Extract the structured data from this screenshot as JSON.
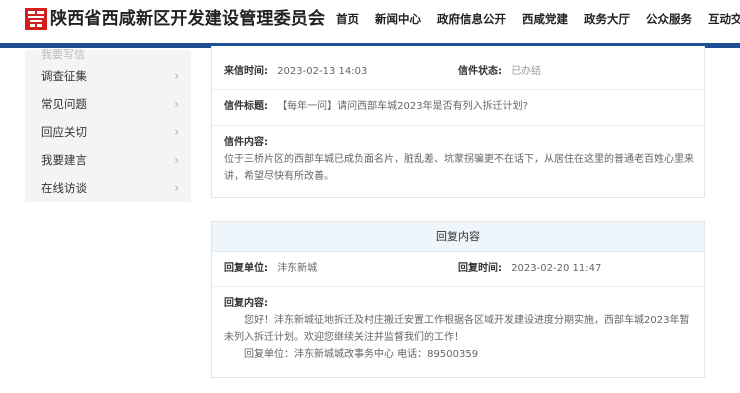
{
  "header": {
    "logo_icon": "red-seal-logo-icon",
    "title": "陕西省西咸新区开发建设管理委员会",
    "nav": [
      "首页",
      "新闻中心",
      "政府信息公开",
      "西咸党建",
      "政务大厅",
      "公众服务",
      "互动交流"
    ],
    "bar_color": "#1f4f95"
  },
  "sidebar": {
    "partial_item": "我要写信",
    "items": [
      "调查征集",
      "常见问题",
      "回应关切",
      "我要建言",
      "在线访谈"
    ],
    "chevron_icon": "chevron-right-icon"
  },
  "letter": {
    "time_label": "来信时间:",
    "time_value": "2023-02-13 14:03",
    "status_label": "信件状态:",
    "status_value": "已办结",
    "subject_label": "信件标题:",
    "subject_value": "【每年一问】请问西部车城2023年是否有列入拆迁计划?",
    "content_label": "信件内容:",
    "content_value": "位于三桥片区的西部车城已成负面名片，脏乱差、坑蒙拐骗更不在话下，从居住在这里的普通老百姓心里来讲，希望尽快有所改善。"
  },
  "reply": {
    "heading": "回复内容",
    "unit_label": "回复单位:",
    "unit_value": "沣东新城",
    "time_label": "回复时间:",
    "time_value": "2023-02-20 11:47",
    "content_label": "回复内容:",
    "content_value": "您好！沣东新城征地拆迁及村庄搬迁安置工作根据各区域开发建设进度分期实施，西部车城2023年暂未列入拆迁计划。欢迎您继续关注并监督我们的工作！",
    "signature": "回复单位：沣东新城城改事务中心  电话：89500359"
  }
}
